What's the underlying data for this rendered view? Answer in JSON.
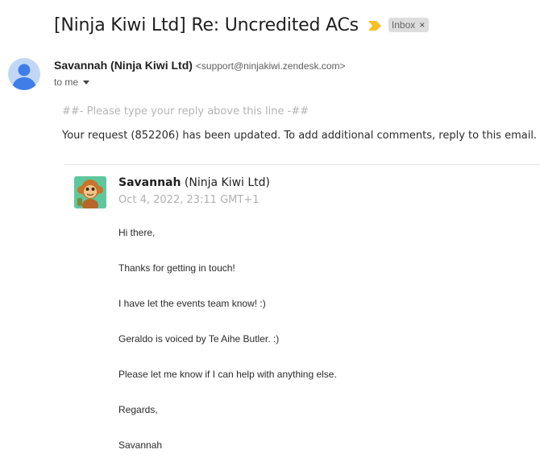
{
  "email": {
    "subject": "[Ninja Kiwi Ltd] Re: Uncredited ACs",
    "label": "Inbox",
    "label_remove_glyph": "×",
    "importance_color": "#f6c026",
    "sender_name": "Savannah (Ninja Kiwi Ltd)",
    "sender_email": "<support@ninjakiwi.zendesk.com>",
    "recipient": "to me",
    "reply_hint": "##- Please type your reply above this line -##",
    "request_text": "Your request (852206) has been updated. To add additional comments, reply to this email."
  },
  "reply": {
    "sender_bold": "Savannah",
    "sender_rest": " (Ninja Kiwi Ltd)",
    "date": "Oct 4, 2022, 23:11 GMT+1",
    "lines": [
      "Hi there,",
      "Thanks for getting in touch!",
      "I have let the events team know! :)",
      "Geraldo is voiced by Te Aihe Butler. :)",
      "Please let me know if I can help with anything else.",
      "Regards,",
      "Savannah"
    ]
  }
}
